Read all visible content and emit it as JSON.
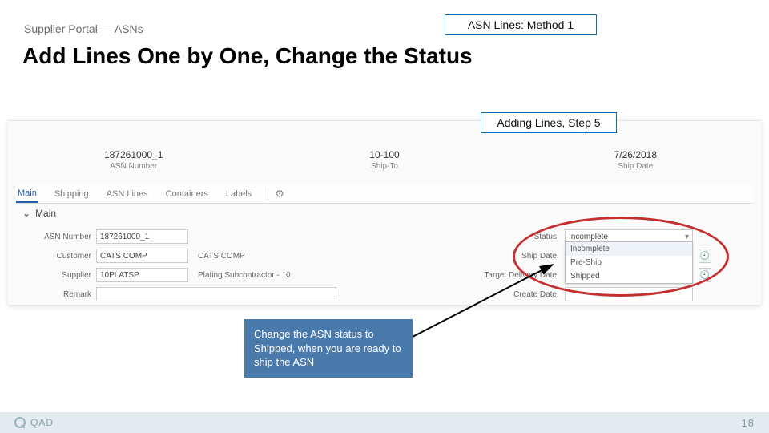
{
  "breadcrumb": "Supplier Portal — ASNs",
  "method_label": "ASN Lines: Method 1",
  "title": "Add Lines One by One, Change the Status",
  "step_label": "Adding Lines, Step 5",
  "summary": {
    "asn_number": {
      "value": "187261000_1",
      "label": "ASN Number"
    },
    "ship_to": {
      "value": "10-100",
      "label": "Ship-To"
    },
    "ship_date": {
      "value": "7/26/2018",
      "label": "Ship Date"
    }
  },
  "tabs": {
    "main": "Main",
    "shipping": "Shipping",
    "asn_lines": "ASN Lines",
    "containers": "Containers",
    "labels": "Labels"
  },
  "section_title": "Main",
  "form": {
    "asn_number": {
      "label": "ASN Number",
      "value": "187261000_1"
    },
    "customer": {
      "label": "Customer",
      "value": "CATS COMP",
      "desc": "CATS COMP"
    },
    "supplier": {
      "label": "Supplier",
      "value": "10PLATSP",
      "desc": "Plating Subcontractor - 10"
    },
    "remark": {
      "label": "Remark",
      "value": ""
    },
    "status": {
      "label": "Status",
      "value": "Incomplete"
    },
    "ship_date": {
      "label": "Ship Date",
      "value": ""
    },
    "target_date": {
      "label": "Target Delivery Date",
      "value": ""
    },
    "create_date": {
      "label": "Create Date",
      "value": ""
    }
  },
  "status_options": [
    "Incomplete",
    "Pre-Ship",
    "Shipped"
  ],
  "callout": "Change the ASN status to Shipped, when you are ready to ship the ASN",
  "footer": {
    "brand": "QAD",
    "page": "18"
  }
}
